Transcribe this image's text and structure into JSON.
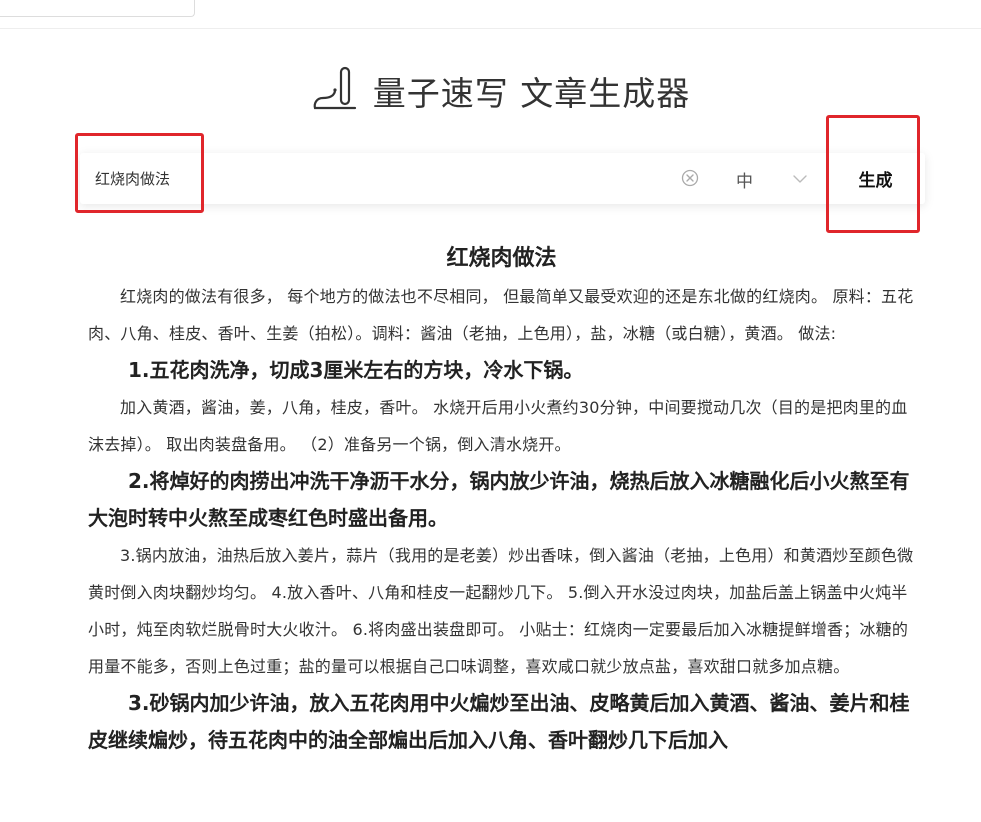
{
  "brand": {
    "logo_icon": "pen-writing-icon",
    "title": "量子速写 文章生成器"
  },
  "search": {
    "value": "红烧肉做法",
    "clear_icon": "clear-circle-icon",
    "length_value": "中",
    "chevron_icon": "chevron-down-icon",
    "generate_label": "生成"
  },
  "colors": {
    "highlight": "#e0262b",
    "text": "#333333"
  },
  "article": {
    "title": "红烧肉做法",
    "blocks": [
      {
        "type": "para",
        "text": "红烧肉的做法有很多， 每个地方的做法也不尽相同， 但最简单又最受欢迎的还是东北做的红烧肉。 原料：五花肉、八角、桂皮、香叶、生姜（拍松）。调料：酱油（老抽，上色用），盐，冰糖（或白糖），黄酒。 做法:"
      },
      {
        "type": "heading",
        "text": "1.五花肉洗净，切成3厘米左右的方块，冷水下锅。"
      },
      {
        "type": "para",
        "text": "加入黄酒，酱油，姜，八角，桂皮，香叶。 水烧开后用小火煮约30分钟，中间要搅动几次（目的是把肉里的血沫去掉）。 取出肉装盘备用。 （2）准备另一个锅，倒入清水烧开。"
      },
      {
        "type": "heading",
        "text": "2.将焯好的肉捞出冲洗干净沥干水分，锅内放少许油，烧热后放入冰糖融化后小火熬至有大泡时转中火熬至成枣红色时盛出备用。"
      },
      {
        "type": "para",
        "text": "3.锅内放油，油热后放入姜片，蒜片（我用的是老姜）炒出香味，倒入酱油（老抽，上色用）和黄酒炒至颜色微黄时倒入肉块翻炒均匀。 4.放入香叶、八角和桂皮一起翻炒几下。 5.倒入开水没过肉块，加盐后盖上锅盖中火炖半小时，炖至肉软烂脱骨时大火收汁。 6.将肉盛出装盘即可。 小贴士：红烧肉一定要最后加入冰糖提鲜增香；冰糖的用量不能多，否则上色过重；盐的量可以根据自己口味调整，喜欢咸口就少放点盐，喜欢甜口就多加点糖。"
      },
      {
        "type": "heading",
        "text": "3.砂锅内加少许油，放入五花肉用中火煸炒至出油、皮略黄后加入黄酒、酱油、姜片和桂皮继续煸炒，待五花肉中的油全部煸出后加入八角、香叶翻炒几下后加入"
      }
    ]
  }
}
